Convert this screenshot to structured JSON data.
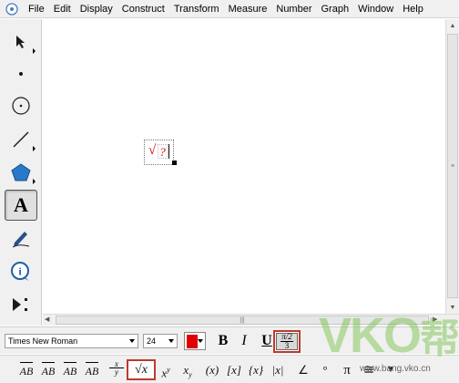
{
  "menubar": {
    "items": [
      "File",
      "Edit",
      "Display",
      "Construct",
      "Transform",
      "Measure",
      "Number",
      "Graph",
      "Window",
      "Help"
    ]
  },
  "toolbox": {
    "tools": [
      {
        "name": "arrow-select-tool",
        "icon": "arrow-icon"
      },
      {
        "name": "point-tool",
        "icon": "point-icon"
      },
      {
        "name": "compass-tool",
        "icon": "circle-icon"
      },
      {
        "name": "straightedge-tool",
        "icon": "line-segment-icon"
      },
      {
        "name": "polygon-tool",
        "icon": "pentagon-icon"
      },
      {
        "name": "text-tool",
        "icon": "text-a-icon",
        "label": "A",
        "selected": true
      },
      {
        "name": "marker-tool",
        "icon": "pen-icon"
      },
      {
        "name": "information-tool",
        "icon": "info-icon",
        "label": "i"
      },
      {
        "name": "custom-tool",
        "icon": "custom-tool-icon"
      }
    ]
  },
  "canvas": {
    "text_object": {
      "root_symbol": "√",
      "placeholder": "?"
    }
  },
  "format_toolbar": {
    "font_family": "Times New Roman",
    "font_size": "24",
    "color": "#e00000",
    "bold_label": "B",
    "italic_label": "I",
    "underline_label": "U",
    "math_format_numerator": "π/2",
    "math_format_denominator": "3"
  },
  "math_toolbar": {
    "buttons": [
      "AB",
      "AB",
      "AB",
      "AB",
      "x/y",
      "√x",
      "xʸ",
      "xᵧ",
      "(x)",
      "[x]",
      "{x}",
      "|x|",
      "∠",
      "°",
      "π",
      "≅",
      "▼"
    ],
    "segment_label": "AB",
    "ray_label": "AB",
    "line_label": "AB",
    "arc_label": "AB",
    "frac_num": "x",
    "frac_den": "y",
    "sqrt_label": "√x",
    "power_base": "x",
    "power_exp": "y",
    "sub_base": "x",
    "sub_idx": "y",
    "paren_label": "(x)",
    "bracket_label": "[x]",
    "brace_label": "{x}",
    "abs_label": "|x|",
    "angle_label": "∠",
    "degree_label": "°",
    "pi_label": "π",
    "congruent_label": "≅",
    "more_label": "▼"
  },
  "watermark": {
    "text": "VKO",
    "glyph": "帮",
    "url": "www.bang.vko.cn"
  }
}
